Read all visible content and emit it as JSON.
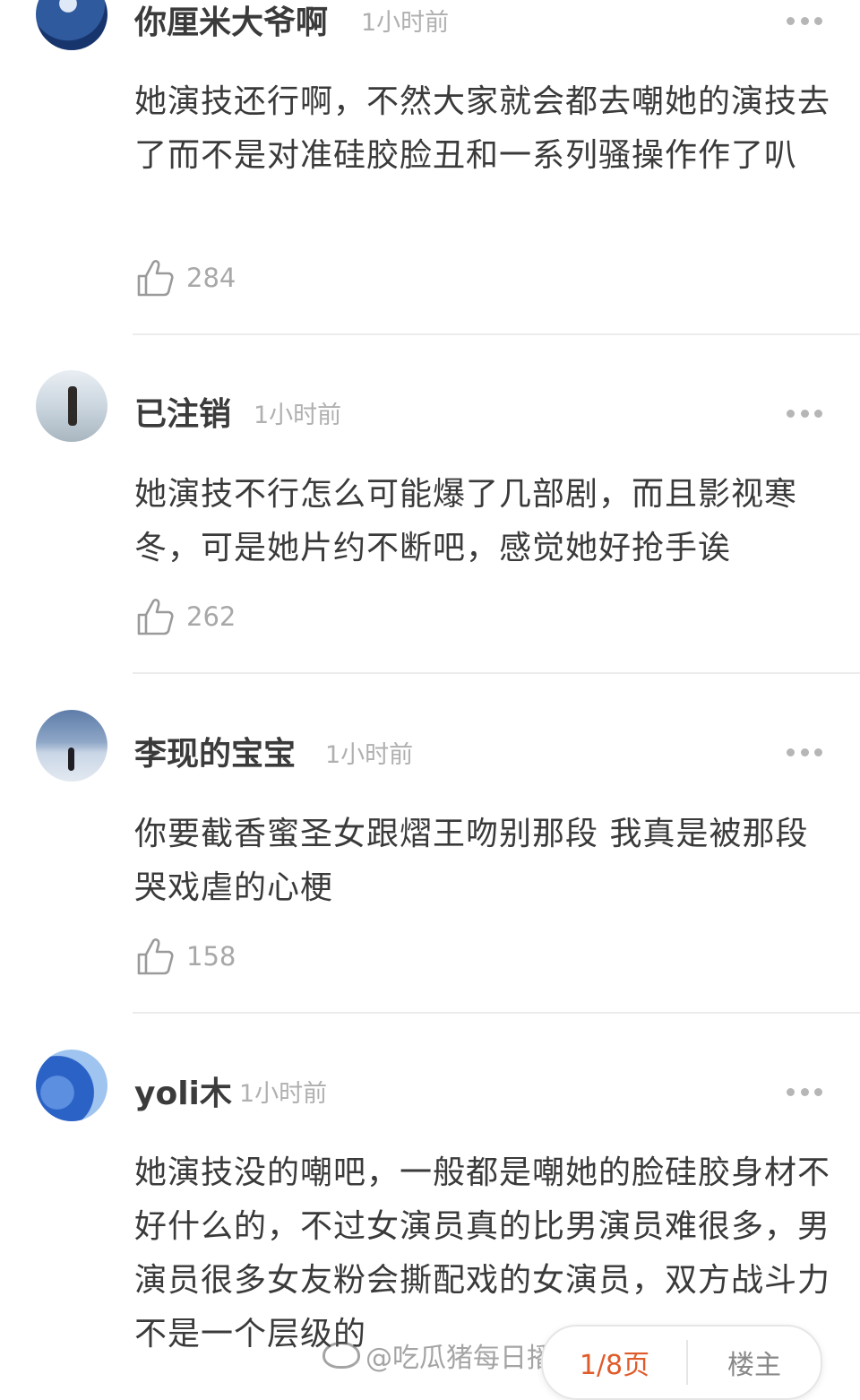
{
  "comments": [
    {
      "name": "你厘米大爷啊",
      "time": "1小时前",
      "text": "她演技还行啊，不然大家就会都去嘲她的演技去了而不是对准硅胶脸丑和一系列骚操作作了叭",
      "likes": "284"
    },
    {
      "name": "已注销",
      "time": "1小时前",
      "text": "她演技不行怎么可能爆了几部剧，而且影视寒冬，可是她片约不断吧，感觉她好抢手诶",
      "likes": "262"
    },
    {
      "name": "李现的宝宝",
      "time": "1小时前",
      "text": "你要截香蜜圣女跟熠王吻别那段 我真是被那段哭戏虐的心梗",
      "likes": "158"
    },
    {
      "name": "yoli木",
      "time": "1小时前",
      "text": "她演技没的嘲吧，一般都是嘲她的脸硅胶身材不好什么的，不过女演员真的比男演员难很多，男演员很多女友粉会撕配戏的女演员，双方战斗力不是一个层级的"
    }
  ],
  "watermark": "@吃瓜猪每日播报",
  "pager": {
    "page": "1/8页",
    "owner": "楼主"
  },
  "icons": {
    "more": "more-dots-icon",
    "like": "thumbs-up-icon",
    "weibo": "weibo-logo-icon"
  }
}
